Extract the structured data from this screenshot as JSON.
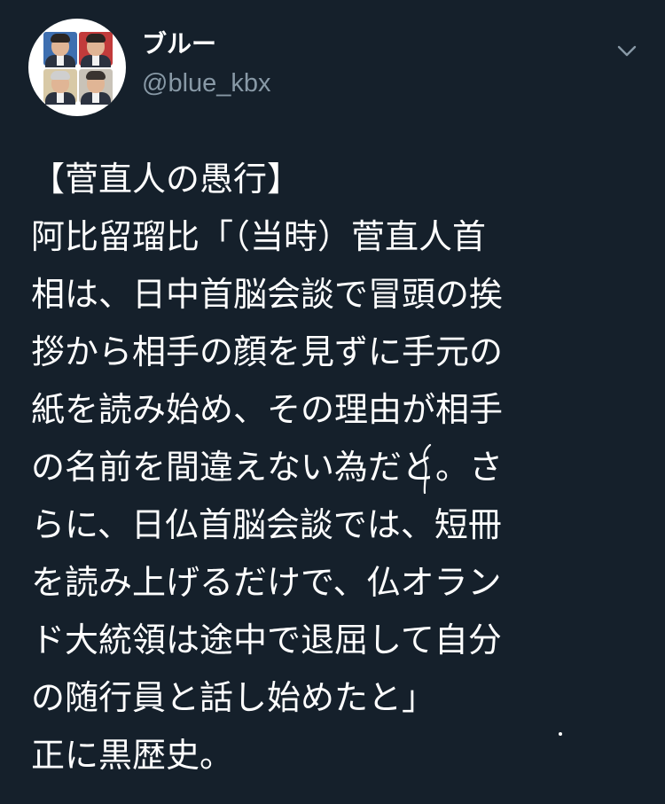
{
  "tweet": {
    "author": {
      "display_name": "ブルー",
      "handle": "@blue_kbx",
      "avatar_icon": "avatar-collage"
    },
    "menu_icon": "chevron-down-icon",
    "lines": [
      "【菅直人の愚行】",
      "阿比留瑠比「（当時）菅直人首",
      "相は、日中首脳会談で冒頭の挨",
      "拶から相手の顔を見ずに手元の",
      "紙を読み始め、その理由が相手",
      "の名前を間違えない為だと。さ",
      "らに、日仏首脳会談では、短冊",
      "を読み上げるだけで、仏オラン",
      "ド大統領は途中で退屈して自分",
      "の随行員と話し始めたと」",
      "正に黒歴史。"
    ]
  },
  "colors": {
    "background": "#15202b",
    "text": "#ffffff",
    "secondary_text": "#8899a6"
  }
}
